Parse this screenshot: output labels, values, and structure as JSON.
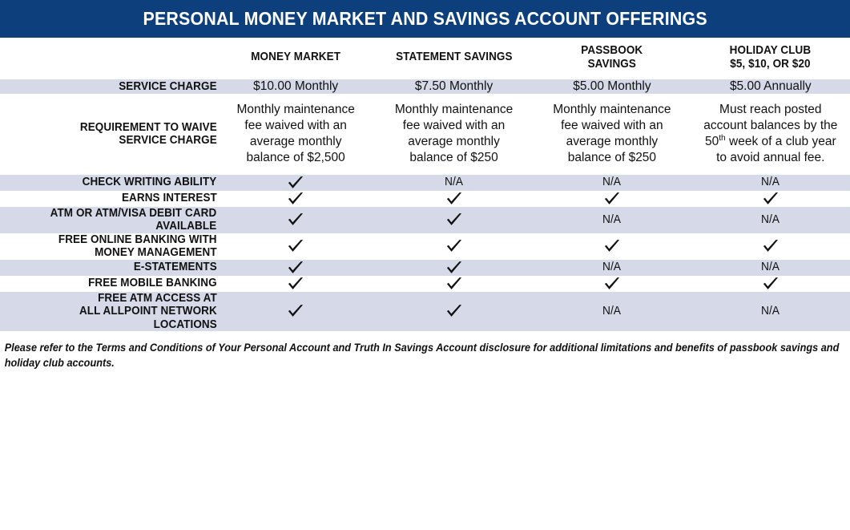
{
  "document": {
    "title": "PERSONAL MONEY MARKET AND SAVINGS ACCOUNT OFFERINGS"
  },
  "colors": {
    "banner": "#0d3f7d",
    "shaded_row": "#d6d9e8",
    "page": "#ffffff",
    "text": "#111111"
  },
  "table": {
    "corner_label": "",
    "columns": [
      {
        "name": "MONEY MARKET",
        "sub": ""
      },
      {
        "name": "STATEMENT SAVINGS",
        "sub": ""
      },
      {
        "name": "PASSBOOK",
        "sub": "SAVINGS"
      },
      {
        "name": "HOLIDAY CLUB",
        "sub": "$5, $10, or $20"
      }
    ],
    "rows": [
      {
        "label": "SERVICE CHARGE",
        "shaded": true,
        "cells": [
          {
            "type": "text",
            "text": "$10.00 Monthly"
          },
          {
            "type": "text",
            "text": "$7.50 Monthly"
          },
          {
            "type": "text",
            "text": "$5.00 Monthly"
          },
          {
            "type": "text",
            "text": "$5.00 Annually"
          }
        ]
      },
      {
        "label": "REQUIREMENT TO WAIVE SERVICE CHARGE",
        "label_lines": [
          "REQUIREMENT TO WAIVE",
          "SERVICE CHARGE"
        ],
        "shaded": false,
        "cells": [
          {
            "type": "text",
            "text": "Monthly maintenance fee waived with an average monthly balance of $2,500"
          },
          {
            "type": "text",
            "text": "Monthly maintenance fee waived with an average monthly balance of $250"
          },
          {
            "type": "text",
            "text": "Monthly maintenance fee waived with an average monthly balance of $250"
          },
          {
            "type": "html",
            "text": "Must reach posted account balances by the 50<sup>th</sup> week of a club year to avoid annual fee."
          }
        ]
      },
      {
        "label": "CHECK WRITING ABILITY",
        "label_lines": [
          "CHECK WRITING ABILITY"
        ],
        "shaded": true,
        "cells": [
          {
            "type": "check",
            "text": "check-icon"
          },
          {
            "type": "text",
            "text": "N/A"
          },
          {
            "type": "text",
            "text": "N/A"
          },
          {
            "type": "text",
            "text": "N/A"
          }
        ]
      },
      {
        "label": "EARNS INTEREST",
        "label_lines": [
          "EARNS INTEREST"
        ],
        "shaded": false,
        "cells": [
          {
            "type": "check",
            "text": "check-icon"
          },
          {
            "type": "check",
            "text": "check-icon"
          },
          {
            "type": "check",
            "text": "check-icon"
          },
          {
            "type": "check",
            "text": "check-icon"
          }
        ]
      },
      {
        "label": "ATM OR ATM/VISA DEBIT CARD AVAILABLE",
        "label_lines": [
          "ATM OR ATM/VISA DEBIT CARD",
          "AVAILABLE"
        ],
        "shaded": true,
        "cells": [
          {
            "type": "check",
            "text": "check-icon"
          },
          {
            "type": "check",
            "text": "check-icon"
          },
          {
            "type": "text",
            "text": "N/A"
          },
          {
            "type": "text",
            "text": "N/A"
          }
        ]
      },
      {
        "label": "FREE ONLINE BANKING WITH MONEY MANAGEMENT",
        "label_lines": [
          "FREE ONLINE BANKING WITH",
          "MONEY MANAGEMENT"
        ],
        "shaded": false,
        "cells": [
          {
            "type": "check",
            "text": "check-icon"
          },
          {
            "type": "check",
            "text": "check-icon"
          },
          {
            "type": "check",
            "text": "check-icon"
          },
          {
            "type": "check",
            "text": "check-icon"
          }
        ]
      },
      {
        "label": "E-STATEMENTS",
        "label_lines": [
          "E-STATEMENTS"
        ],
        "shaded": true,
        "cells": [
          {
            "type": "check",
            "text": "check-icon"
          },
          {
            "type": "check",
            "text": "check-icon"
          },
          {
            "type": "text",
            "text": "N/A"
          },
          {
            "type": "text",
            "text": "N/A"
          }
        ]
      },
      {
        "label": "FREE MOBILE BANKING",
        "label_lines": [
          "FREE MOBILE BANKING"
        ],
        "shaded": false,
        "cells": [
          {
            "type": "check",
            "text": "check-icon"
          },
          {
            "type": "check",
            "text": "check-icon"
          },
          {
            "type": "check",
            "text": "check-icon"
          },
          {
            "type": "check",
            "text": "check-icon"
          }
        ]
      },
      {
        "label": "FREE ATM ACCESS AT ALL ALLPOINT NETWORK LOCATIONS",
        "label_lines": [
          "FREE ATM ACCESS AT",
          "ALL ALLPOINT NETWORK",
          "LOCATIONS"
        ],
        "shaded": true,
        "cells": [
          {
            "type": "check",
            "text": "check-icon"
          },
          {
            "type": "check",
            "text": "check-icon"
          },
          {
            "type": "text",
            "text": "N/A"
          },
          {
            "type": "text",
            "text": "N/A"
          }
        ]
      }
    ]
  },
  "footnote": {
    "text": "Please refer to the Terms and Conditions of Your Personal Account and Truth In Savings Account disclosure for additional limitations and benefits of passbook savings and holiday club accounts."
  }
}
